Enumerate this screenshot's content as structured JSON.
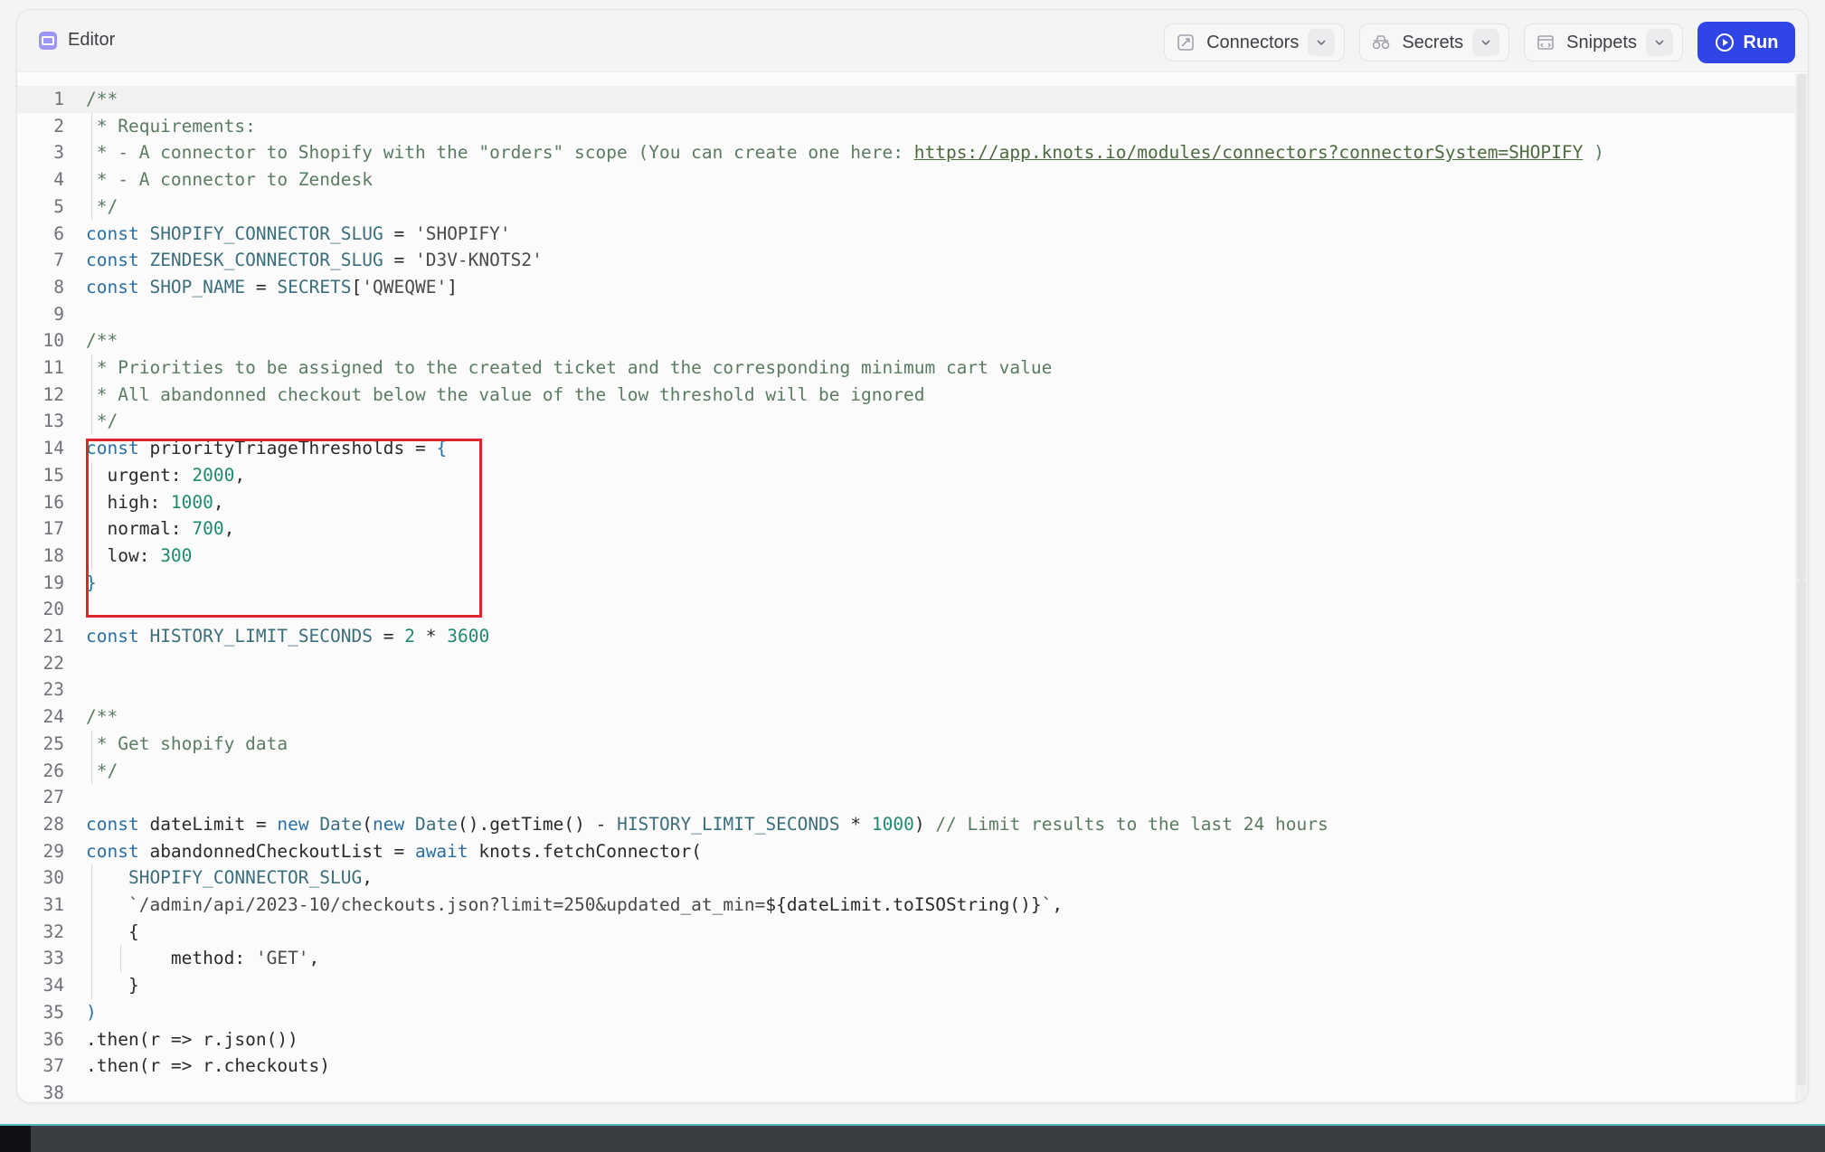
{
  "header": {
    "title": "Editor",
    "icon": "editor-icon",
    "buttons": [
      {
        "label": "Connectors",
        "icon": "connectors-icon"
      },
      {
        "label": "Secrets",
        "icon": "secrets-icon"
      },
      {
        "label": "Snippets",
        "icon": "snippets-icon"
      }
    ],
    "run_label": "Run"
  },
  "colors": {
    "run_button": "#2f45e6",
    "highlight_box": "#e0262b",
    "keyword": "#2b6fa5",
    "number": "#1f8a6e",
    "comment": "#5b7b62"
  },
  "editor": {
    "active_line": 1,
    "lines": [
      {
        "n": "1",
        "tokens": [
          [
            "cmt",
            "/**"
          ]
        ]
      },
      {
        "n": "2",
        "tokens": [
          [
            "cmt",
            " * Requirements:"
          ]
        ]
      },
      {
        "n": "3",
        "tokens": [
          [
            "cmt",
            " * - A connector to Shopify with the \"orders\" scope (You can create one here: "
          ],
          [
            "link",
            "https://app.knots.io/modules/connectors?connectorSystem=SHOPIFY"
          ],
          [
            "cmt",
            " )"
          ]
        ]
      },
      {
        "n": "4",
        "tokens": [
          [
            "cmt",
            " * - A connector to Zendesk"
          ]
        ]
      },
      {
        "n": "5",
        "tokens": [
          [
            "cmt",
            " */"
          ]
        ]
      },
      {
        "n": "6",
        "tokens": [
          [
            "kw",
            "const "
          ],
          [
            "cons",
            "SHOPIFY_CONNECTOR_SLUG"
          ],
          [
            "fn",
            " = "
          ],
          [
            "str",
            "'SHOPIFY'"
          ]
        ]
      },
      {
        "n": "7",
        "tokens": [
          [
            "kw",
            "const "
          ],
          [
            "cons",
            "ZENDESK_CONNECTOR_SLUG"
          ],
          [
            "fn",
            " = "
          ],
          [
            "str",
            "'D3V-KNOTS2'"
          ]
        ]
      },
      {
        "n": "8",
        "tokens": [
          [
            "kw",
            "const "
          ],
          [
            "cons",
            "SHOP_NAME"
          ],
          [
            "fn",
            " = "
          ],
          [
            "cons",
            "SECRETS"
          ],
          [
            "fn",
            "["
          ],
          [
            "str",
            "'QWEQWE'"
          ],
          [
            "fn",
            "]"
          ]
        ]
      },
      {
        "n": "9",
        "tokens": []
      },
      {
        "n": "10",
        "tokens": [
          [
            "cmt",
            "/**"
          ]
        ]
      },
      {
        "n": "11",
        "tokens": [
          [
            "cmt",
            " * Priorities to be assigned to the created ticket and the corresponding minimum cart value"
          ]
        ]
      },
      {
        "n": "12",
        "tokens": [
          [
            "cmt",
            " * All abandonned checkout below the value of the low threshold will be ignored"
          ]
        ]
      },
      {
        "n": "13",
        "tokens": [
          [
            "cmt",
            " */"
          ]
        ]
      },
      {
        "n": "14",
        "tokens": [
          [
            "kw",
            "const "
          ],
          [
            "fn",
            "priorityTriageThresholds = "
          ],
          [
            "kw",
            "{"
          ]
        ]
      },
      {
        "n": "15",
        "tokens": [
          [
            "fn",
            "  urgent: "
          ],
          [
            "num",
            "2000"
          ],
          [
            "fn",
            ","
          ]
        ]
      },
      {
        "n": "16",
        "tokens": [
          [
            "fn",
            "  high: "
          ],
          [
            "num",
            "1000"
          ],
          [
            "fn",
            ","
          ]
        ]
      },
      {
        "n": "17",
        "tokens": [
          [
            "fn",
            "  normal: "
          ],
          [
            "num",
            "700"
          ],
          [
            "fn",
            ","
          ]
        ]
      },
      {
        "n": "18",
        "tokens": [
          [
            "fn",
            "  low: "
          ],
          [
            "num",
            "300"
          ]
        ]
      },
      {
        "n": "19",
        "tokens": [
          [
            "kw",
            "}"
          ]
        ]
      },
      {
        "n": "20",
        "tokens": []
      },
      {
        "n": "21",
        "tokens": [
          [
            "kw",
            "const "
          ],
          [
            "cons",
            "HISTORY_LIMIT_SECONDS"
          ],
          [
            "fn",
            " = "
          ],
          [
            "num",
            "2"
          ],
          [
            "fn",
            " * "
          ],
          [
            "num",
            "3600"
          ]
        ]
      },
      {
        "n": "22",
        "tokens": []
      },
      {
        "n": "23",
        "tokens": []
      },
      {
        "n": "24",
        "tokens": [
          [
            "cmt",
            "/**"
          ]
        ]
      },
      {
        "n": "25",
        "tokens": [
          [
            "cmt",
            " * Get shopify data"
          ]
        ]
      },
      {
        "n": "26",
        "tokens": [
          [
            "cmt",
            " */"
          ]
        ]
      },
      {
        "n": "27",
        "tokens": []
      },
      {
        "n": "28",
        "tokens": [
          [
            "kw",
            "const "
          ],
          [
            "fn",
            "dateLimit = "
          ],
          [
            "kw",
            "new "
          ],
          [
            "cons",
            "Date"
          ],
          [
            "fn",
            "("
          ],
          [
            "kw",
            "new "
          ],
          [
            "cons",
            "Date"
          ],
          [
            "fn",
            "().getTime() - "
          ],
          [
            "cons",
            "HISTORY_LIMIT_SECONDS"
          ],
          [
            "fn",
            " * "
          ],
          [
            "num",
            "1000"
          ],
          [
            "fn",
            ") "
          ],
          [
            "cmt",
            "// Limit results to the last 24 hours"
          ]
        ]
      },
      {
        "n": "29",
        "tokens": [
          [
            "kw",
            "const "
          ],
          [
            "fn",
            "abandonnedCheckoutList = "
          ],
          [
            "kw",
            "await "
          ],
          [
            "fn",
            "knots.fetchConnector("
          ]
        ]
      },
      {
        "n": "30",
        "tokens": [
          [
            "cons",
            "    SHOPIFY_CONNECTOR_SLUG"
          ],
          [
            "fn",
            ","
          ]
        ]
      },
      {
        "n": "31",
        "tokens": [
          [
            "str",
            "    `/admin/api/2023-10/checkouts.json?limit=250&updated_at_min="
          ],
          [
            "fn",
            "${dateLimit.toISOString()}"
          ],
          [
            "str",
            "`"
          ],
          [
            "fn",
            ","
          ]
        ]
      },
      {
        "n": "32",
        "tokens": [
          [
            "fn",
            "    {"
          ]
        ]
      },
      {
        "n": "33",
        "tokens": [
          [
            "fn",
            "        method: "
          ],
          [
            "str",
            "'GET'"
          ],
          [
            "fn",
            ","
          ]
        ]
      },
      {
        "n": "34",
        "tokens": [
          [
            "fn",
            "    }"
          ]
        ]
      },
      {
        "n": "35",
        "tokens": [
          [
            "kw",
            ")"
          ]
        ]
      },
      {
        "n": "36",
        "tokens": [
          [
            "fn",
            ".then(r => r.json())"
          ]
        ]
      },
      {
        "n": "37",
        "tokens": [
          [
            "fn",
            ".then(r => r.checkouts)"
          ]
        ]
      },
      {
        "n": "38",
        "tokens": []
      }
    ]
  }
}
